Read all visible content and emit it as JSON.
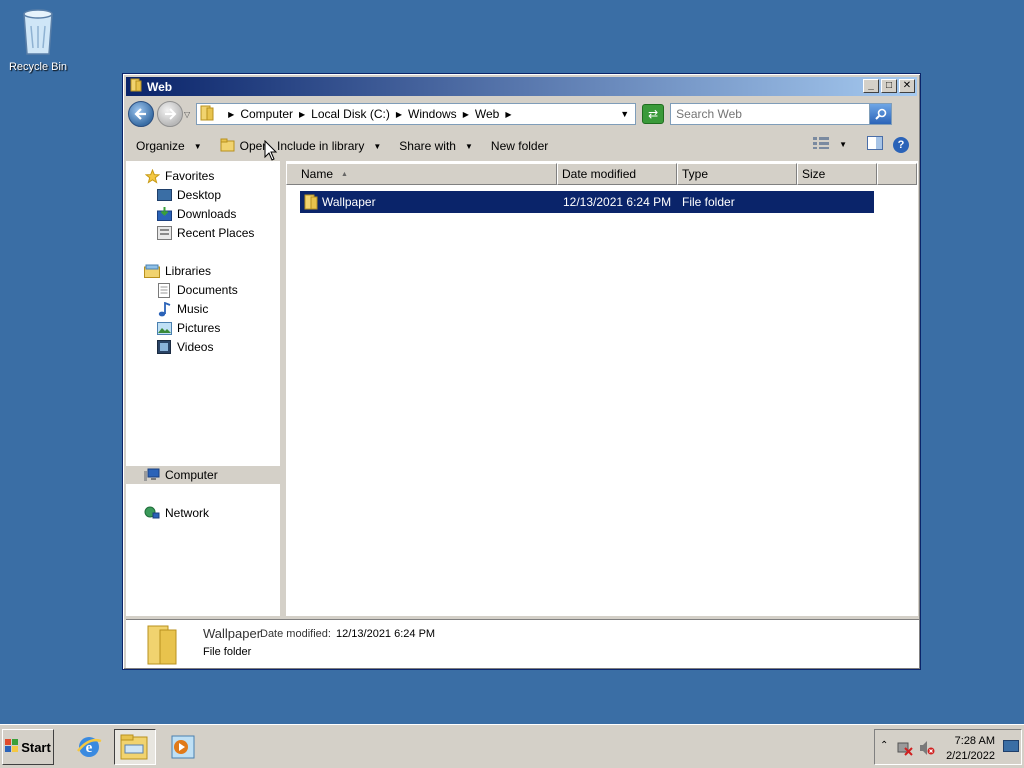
{
  "desktop": {
    "recycle_bin_label": "Recycle Bin"
  },
  "window": {
    "title": "Web",
    "buttons": {
      "minimize": "_",
      "maximize": "□",
      "close": "✕"
    }
  },
  "address": {
    "breadcrumbs": [
      "Computer",
      "Local Disk (C:)",
      "Windows",
      "Web"
    ],
    "search_placeholder": "Search Web"
  },
  "toolbar": {
    "organize": "Organize",
    "open": "Open",
    "include_in_library": "Include in library",
    "share_with": "Share with",
    "new_folder": "New folder"
  },
  "nav": {
    "favorites": "Favorites",
    "desktop": "Desktop",
    "downloads": "Downloads",
    "recent_places": "Recent Places",
    "libraries": "Libraries",
    "documents": "Documents",
    "music": "Music",
    "pictures": "Pictures",
    "videos": "Videos",
    "computer": "Computer",
    "network": "Network"
  },
  "columns": {
    "name": "Name",
    "date_modified": "Date modified",
    "type": "Type",
    "size": "Size"
  },
  "files": [
    {
      "name": "Wallpaper",
      "date": "12/13/2021 6:24 PM",
      "type": "File folder",
      "size": ""
    }
  ],
  "details": {
    "name": "Wallpaper",
    "date_label": "Date modified:",
    "date_value": "12/13/2021 6:24 PM",
    "type": "File folder"
  },
  "taskbar": {
    "start_label": "Start",
    "time": "7:28 AM",
    "date": "2/21/2022"
  },
  "icons": {
    "folder": "folder-icon",
    "recycle": "recycle-bin-icon",
    "star": "star-icon",
    "ie": "internet-explorer-icon",
    "explorer": "explorer-icon",
    "media": "media-player-icon"
  },
  "colors": {
    "desktop": "#3a6ea5",
    "title_start": "#0a246a",
    "selection": "#0a246a",
    "chrome": "#d4d0c8"
  }
}
